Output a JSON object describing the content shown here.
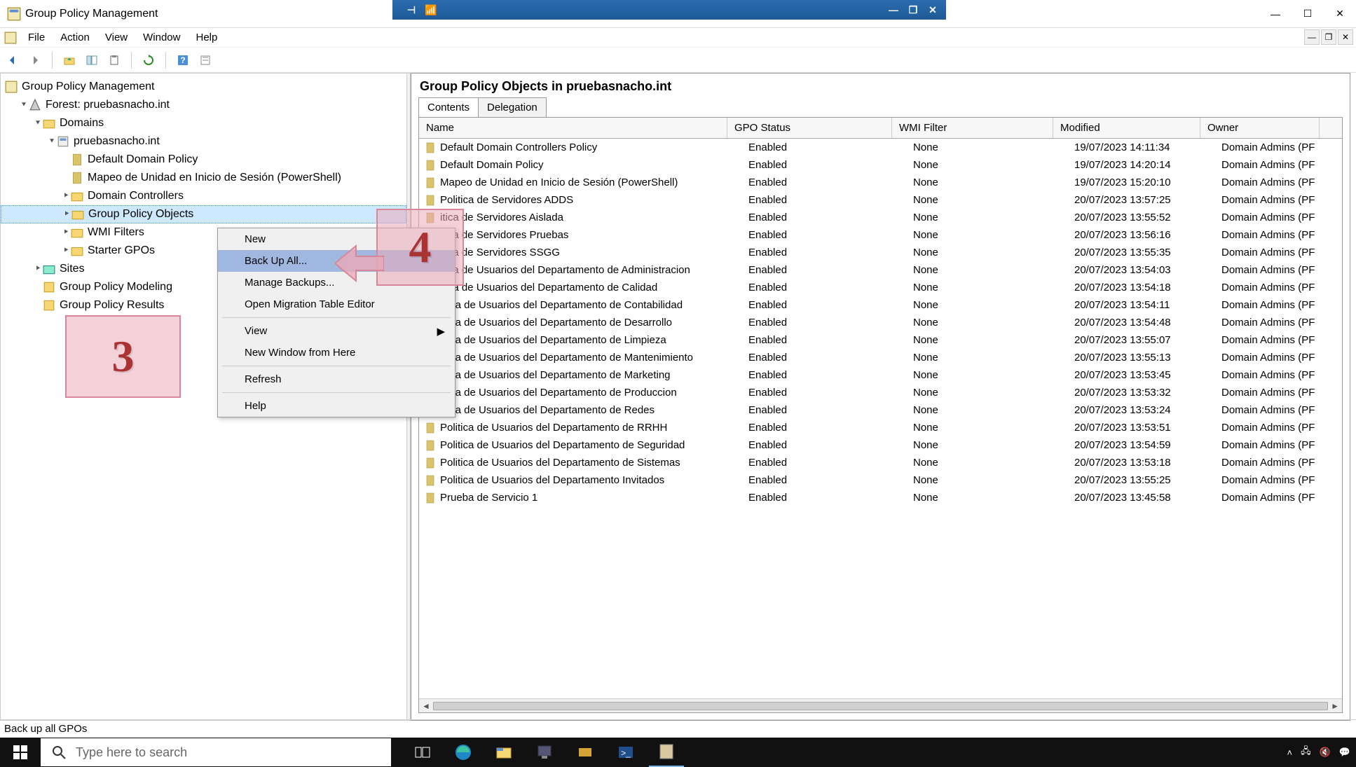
{
  "window": {
    "title": "Group Policy Management"
  },
  "menu": {
    "file": "File",
    "action": "Action",
    "view": "View",
    "window": "Window",
    "help": "Help"
  },
  "tree": {
    "root": "Group Policy Management",
    "forest": "Forest: pruebasnacho.int",
    "domains": "Domains",
    "domain": "pruebasnacho.int",
    "defaultDomainPolicy": "Default Domain Policy",
    "mapeo": "Mapeo de Unidad en Inicio de Sesión (PowerShell)",
    "domainControllers": "Domain Controllers",
    "gpObjects": "Group Policy Objects",
    "wmiFilters": "WMI Filters",
    "starterGpos": "Starter GPOs",
    "sites": "Sites",
    "modeling": "Group Policy Modeling",
    "results": "Group Policy Results"
  },
  "context": {
    "new": "New",
    "backUpAll": "Back Up All...",
    "manageBackups": "Manage Backups...",
    "openMigration": "Open Migration Table Editor",
    "view": "View",
    "newWindow": "New Window from Here",
    "refresh": "Refresh",
    "help": "Help"
  },
  "content": {
    "heading": "Group Policy Objects in pruebasnacho.int",
    "tabs": {
      "contents": "Contents",
      "delegation": "Delegation"
    },
    "cols": {
      "name": "Name",
      "status": "GPO Status",
      "wmi": "WMI Filter",
      "modified": "Modified",
      "owner": "Owner"
    },
    "rows": [
      {
        "name": "Default Domain Controllers Policy",
        "status": "Enabled",
        "wmi": "None",
        "mod": "19/07/2023 14:11:34",
        "own": "Domain Admins (PF"
      },
      {
        "name": "Default Domain Policy",
        "status": "Enabled",
        "wmi": "None",
        "mod": "19/07/2023 14:20:14",
        "own": "Domain Admins (PF"
      },
      {
        "name": "Mapeo de Unidad en Inicio de Sesión (PowerShell)",
        "status": "Enabled",
        "wmi": "None",
        "mod": "19/07/2023 15:20:10",
        "own": "Domain Admins (PF"
      },
      {
        "name": "Politica de Servidores ADDS",
        "status": "Enabled",
        "wmi": "None",
        "mod": "20/07/2023 13:57:25",
        "own": "Domain Admins (PF"
      },
      {
        "name": "itica de Servidores Aislada",
        "status": "Enabled",
        "wmi": "None",
        "mod": "20/07/2023 13:55:52",
        "own": "Domain Admins (PF"
      },
      {
        "name": "itica de Servidores Pruebas",
        "status": "Enabled",
        "wmi": "None",
        "mod": "20/07/2023 13:56:16",
        "own": "Domain Admins (PF"
      },
      {
        "name": "itica de Servidores SSGG",
        "status": "Enabled",
        "wmi": "None",
        "mod": "20/07/2023 13:55:35",
        "own": "Domain Admins (PF"
      },
      {
        "name": "itica de Usuarios del Departamento de Administracion",
        "status": "Enabled",
        "wmi": "None",
        "mod": "20/07/2023 13:54:03",
        "own": "Domain Admins (PF"
      },
      {
        "name": "itica de Usuarios del Departamento de Calidad",
        "status": "Enabled",
        "wmi": "None",
        "mod": "20/07/2023 13:54:18",
        "own": "Domain Admins (PF"
      },
      {
        "name": "litica de Usuarios del Departamento de Contabilidad",
        "status": "Enabled",
        "wmi": "None",
        "mod": "20/07/2023 13:54:11",
        "own": "Domain Admins (PF"
      },
      {
        "name": "litica de Usuarios del Departamento de Desarrollo",
        "status": "Enabled",
        "wmi": "None",
        "mod": "20/07/2023 13:54:48",
        "own": "Domain Admins (PF"
      },
      {
        "name": "litica de Usuarios del Departamento de Limpieza",
        "status": "Enabled",
        "wmi": "None",
        "mod": "20/07/2023 13:55:07",
        "own": "Domain Admins (PF"
      },
      {
        "name": "litica de Usuarios del Departamento de Mantenimiento",
        "status": "Enabled",
        "wmi": "None",
        "mod": "20/07/2023 13:55:13",
        "own": "Domain Admins (PF"
      },
      {
        "name": "litica de Usuarios del Departamento de Marketing",
        "status": "Enabled",
        "wmi": "None",
        "mod": "20/07/2023 13:53:45",
        "own": "Domain Admins (PF"
      },
      {
        "name": "litica de Usuarios del Departamento de Produccion",
        "status": "Enabled",
        "wmi": "None",
        "mod": "20/07/2023 13:53:32",
        "own": "Domain Admins (PF"
      },
      {
        "name": "litica de Usuarios del Departamento de Redes",
        "status": "Enabled",
        "wmi": "None",
        "mod": "20/07/2023 13:53:24",
        "own": "Domain Admins (PF"
      },
      {
        "name": "Politica de Usuarios del Departamento de RRHH",
        "status": "Enabled",
        "wmi": "None",
        "mod": "20/07/2023 13:53:51",
        "own": "Domain Admins (PF"
      },
      {
        "name": "Politica de Usuarios del Departamento de Seguridad",
        "status": "Enabled",
        "wmi": "None",
        "mod": "20/07/2023 13:54:59",
        "own": "Domain Admins (PF"
      },
      {
        "name": "Politica de Usuarios del Departamento de Sistemas",
        "status": "Enabled",
        "wmi": "None",
        "mod": "20/07/2023 13:53:18",
        "own": "Domain Admins (PF"
      },
      {
        "name": "Politica de Usuarios del Departamento Invitados",
        "status": "Enabled",
        "wmi": "None",
        "mod": "20/07/2023 13:55:25",
        "own": "Domain Admins (PF"
      },
      {
        "name": "Prueba de Servicio 1",
        "status": "Enabled",
        "wmi": "None",
        "mod": "20/07/2023 13:45:58",
        "own": "Domain Admins (PF"
      }
    ]
  },
  "status": "Back up all GPOs",
  "search": {
    "placeholder": "Type here to search"
  },
  "annot": {
    "three": "3",
    "four": "4"
  }
}
